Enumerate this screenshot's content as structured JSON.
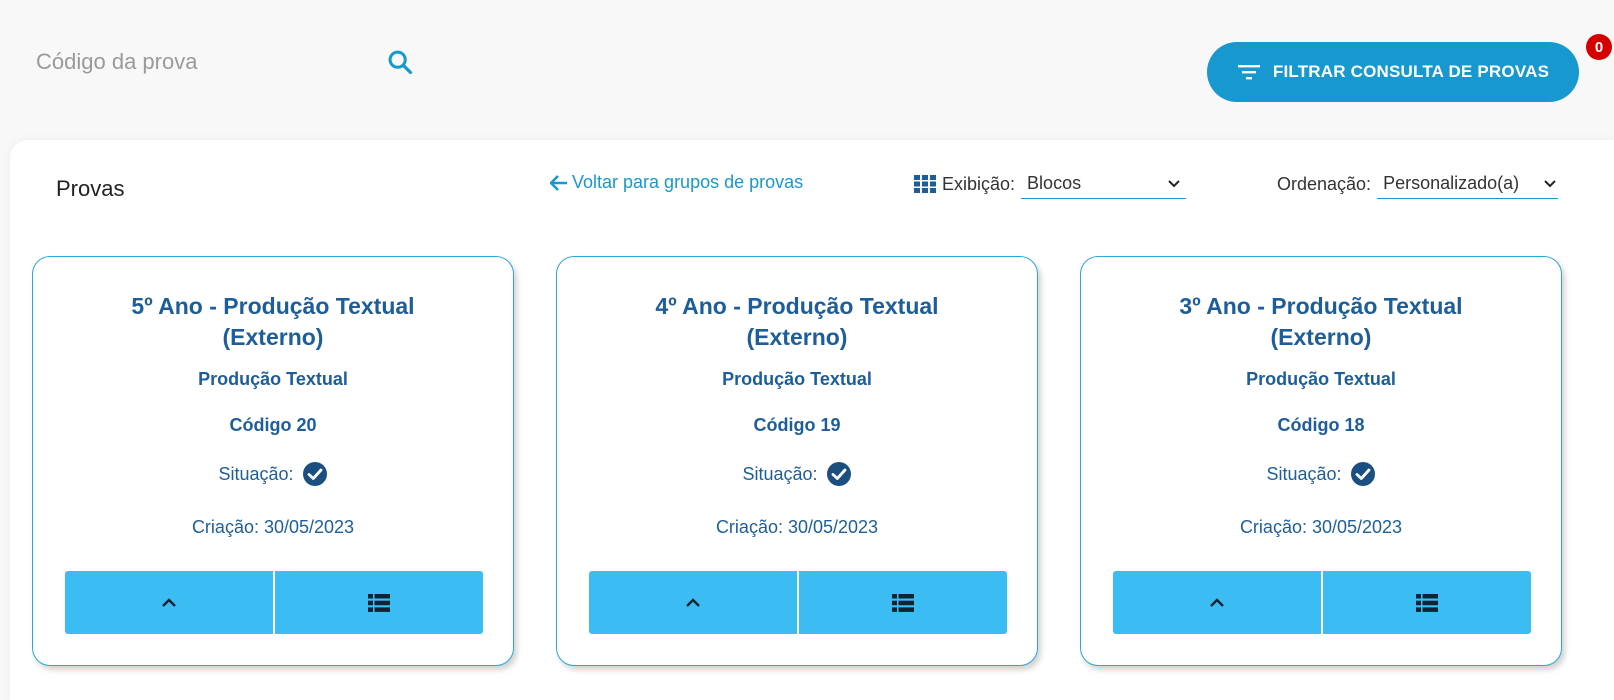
{
  "search": {
    "placeholder": "Código da prova",
    "value": ""
  },
  "filter": {
    "label": "FILTRAR CONSULTA DE PROVAS",
    "badge_count": "0"
  },
  "panel": {
    "title": "Provas",
    "back_link": "Voltar para grupos de provas",
    "display_label": "Exibição:",
    "display_value": "Blocos",
    "order_label": "Ordenação:",
    "order_value": "Personalizado(a)"
  },
  "cards": [
    {
      "title_line1": "5º Ano - Produção Textual",
      "title_line2": "(Externo)",
      "subject": "Produção Textual",
      "code": "Código 20",
      "status_label": "Situação:",
      "created": "Criação: 30/05/2023"
    },
    {
      "title_line1": "4º Ano - Produção Textual",
      "title_line2": "(Externo)",
      "subject": "Produção Textual",
      "code": "Código 19",
      "status_label": "Situação:",
      "created": "Criação: 30/05/2023"
    },
    {
      "title_line1": "3º Ano - Produção Textual",
      "title_line2": "(Externo)",
      "subject": "Produção Textual",
      "code": "Código 18",
      "status_label": "Situação:",
      "created": "Criação: 30/05/2023"
    }
  ],
  "icons": {
    "search": "search-icon",
    "filter": "filter-icon",
    "back": "arrow-left-icon",
    "grid": "grid-icon",
    "chevron": "chevron-down-icon",
    "status": "check-circle-icon",
    "expand": "chevron-up-icon",
    "list": "list-icon"
  },
  "colors": {
    "accent": "#1798cf",
    "card_button": "#3bbdf3",
    "title_text": "#1d5e9a",
    "badge": "#d40000",
    "status_check": "#1a4f80"
  }
}
